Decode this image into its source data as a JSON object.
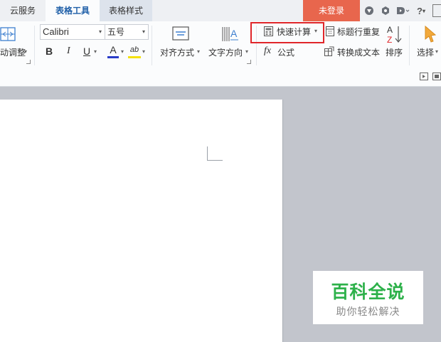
{
  "tabs": [
    {
      "label": "云服务"
    },
    {
      "label": "表格工具"
    },
    {
      "label": "表格样式"
    }
  ],
  "login_label": "未登录",
  "toolbar_right": {
    "help_glyph": "?",
    "dropdown_glyph": "▾"
  },
  "ribbon": {
    "autofit_label": "动调整",
    "font_name": "Calibri",
    "font_size": "五号",
    "bold": "B",
    "italic": "I",
    "underline": "U",
    "font_color_glyph": "A",
    "highlight_glyph": "ab",
    "align_label": "对齐方式",
    "text_direction_label": "文字方向",
    "quick_calc_label": "快速计算",
    "formula_glyph": "fx",
    "formula_label": "公式",
    "repeat_header_label": "标题行重复",
    "to_text_label": "转换成文本",
    "sort_label": "排序",
    "select_label": "选择"
  },
  "colors": {
    "accent_blue": "#1f5fa8",
    "login_bg": "#e8664d",
    "highlight_red": "#e0262a",
    "font_color_bar": "#2a3cc8",
    "highlight_bar": "#f5e10a",
    "watermark_green": "#2db14a"
  },
  "watermark": {
    "title": "百科全说",
    "subtitle": "助你轻松解决"
  }
}
